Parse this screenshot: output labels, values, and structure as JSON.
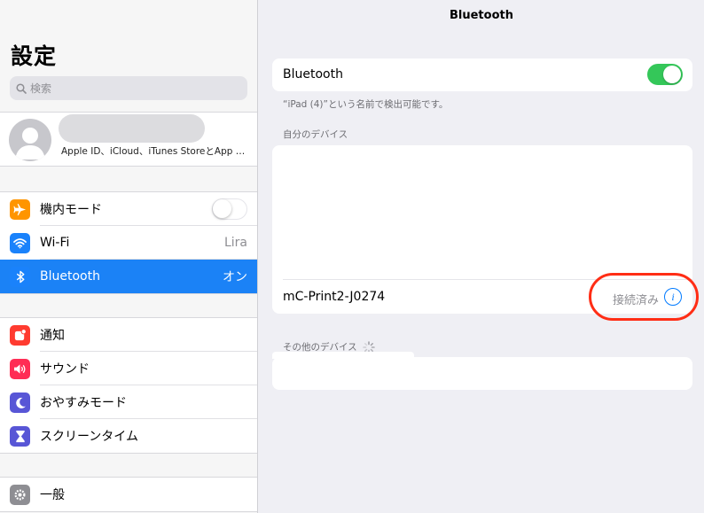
{
  "sidebar": {
    "title": "設定",
    "search_placeholder": "検索",
    "profile": {
      "subtitle": "Apple ID、iCloud、iTunes StoreとApp S..."
    },
    "groups": [
      {
        "items": [
          {
            "label": "機内モード",
            "icon": "airplane-icon",
            "color": "#ff9500",
            "accessory": "toggle-off"
          },
          {
            "label": "Wi-Fi",
            "icon": "wifi-icon",
            "color": "#1a82fb",
            "value": "Lira"
          },
          {
            "label": "Bluetooth",
            "icon": "bluetooth-icon",
            "color": "#1a82fb",
            "value": "オン",
            "selected": true
          }
        ]
      },
      {
        "items": [
          {
            "label": "通知",
            "icon": "notifications-icon",
            "color": "#ff3b30"
          },
          {
            "label": "サウンド",
            "icon": "sound-icon",
            "color": "#ff2d55"
          },
          {
            "label": "おやすみモード",
            "icon": "moon-icon",
            "color": "#5856d6"
          },
          {
            "label": "スクリーンタイム",
            "icon": "hourglass-icon",
            "color": "#5856d6"
          }
        ]
      },
      {
        "items": [
          {
            "label": "一般",
            "icon": "gear-icon",
            "color": "#8e8e93"
          }
        ]
      }
    ]
  },
  "detail": {
    "title": "Bluetooth",
    "bluetooth_label": "Bluetooth",
    "bluetooth_on": true,
    "visible_note": "“iPad (4)”という名前で検出可能です。",
    "my_devices_header": "自分のデバイス",
    "device": {
      "name": "mC-Print2-J0274",
      "status": "接続済み"
    },
    "other_devices_header": "その他のデバイス"
  },
  "colors": {
    "accent": "#007aff",
    "selected_row": "#1b82f6",
    "toggle_on": "#34c759",
    "highlight": "#ff2d15"
  }
}
